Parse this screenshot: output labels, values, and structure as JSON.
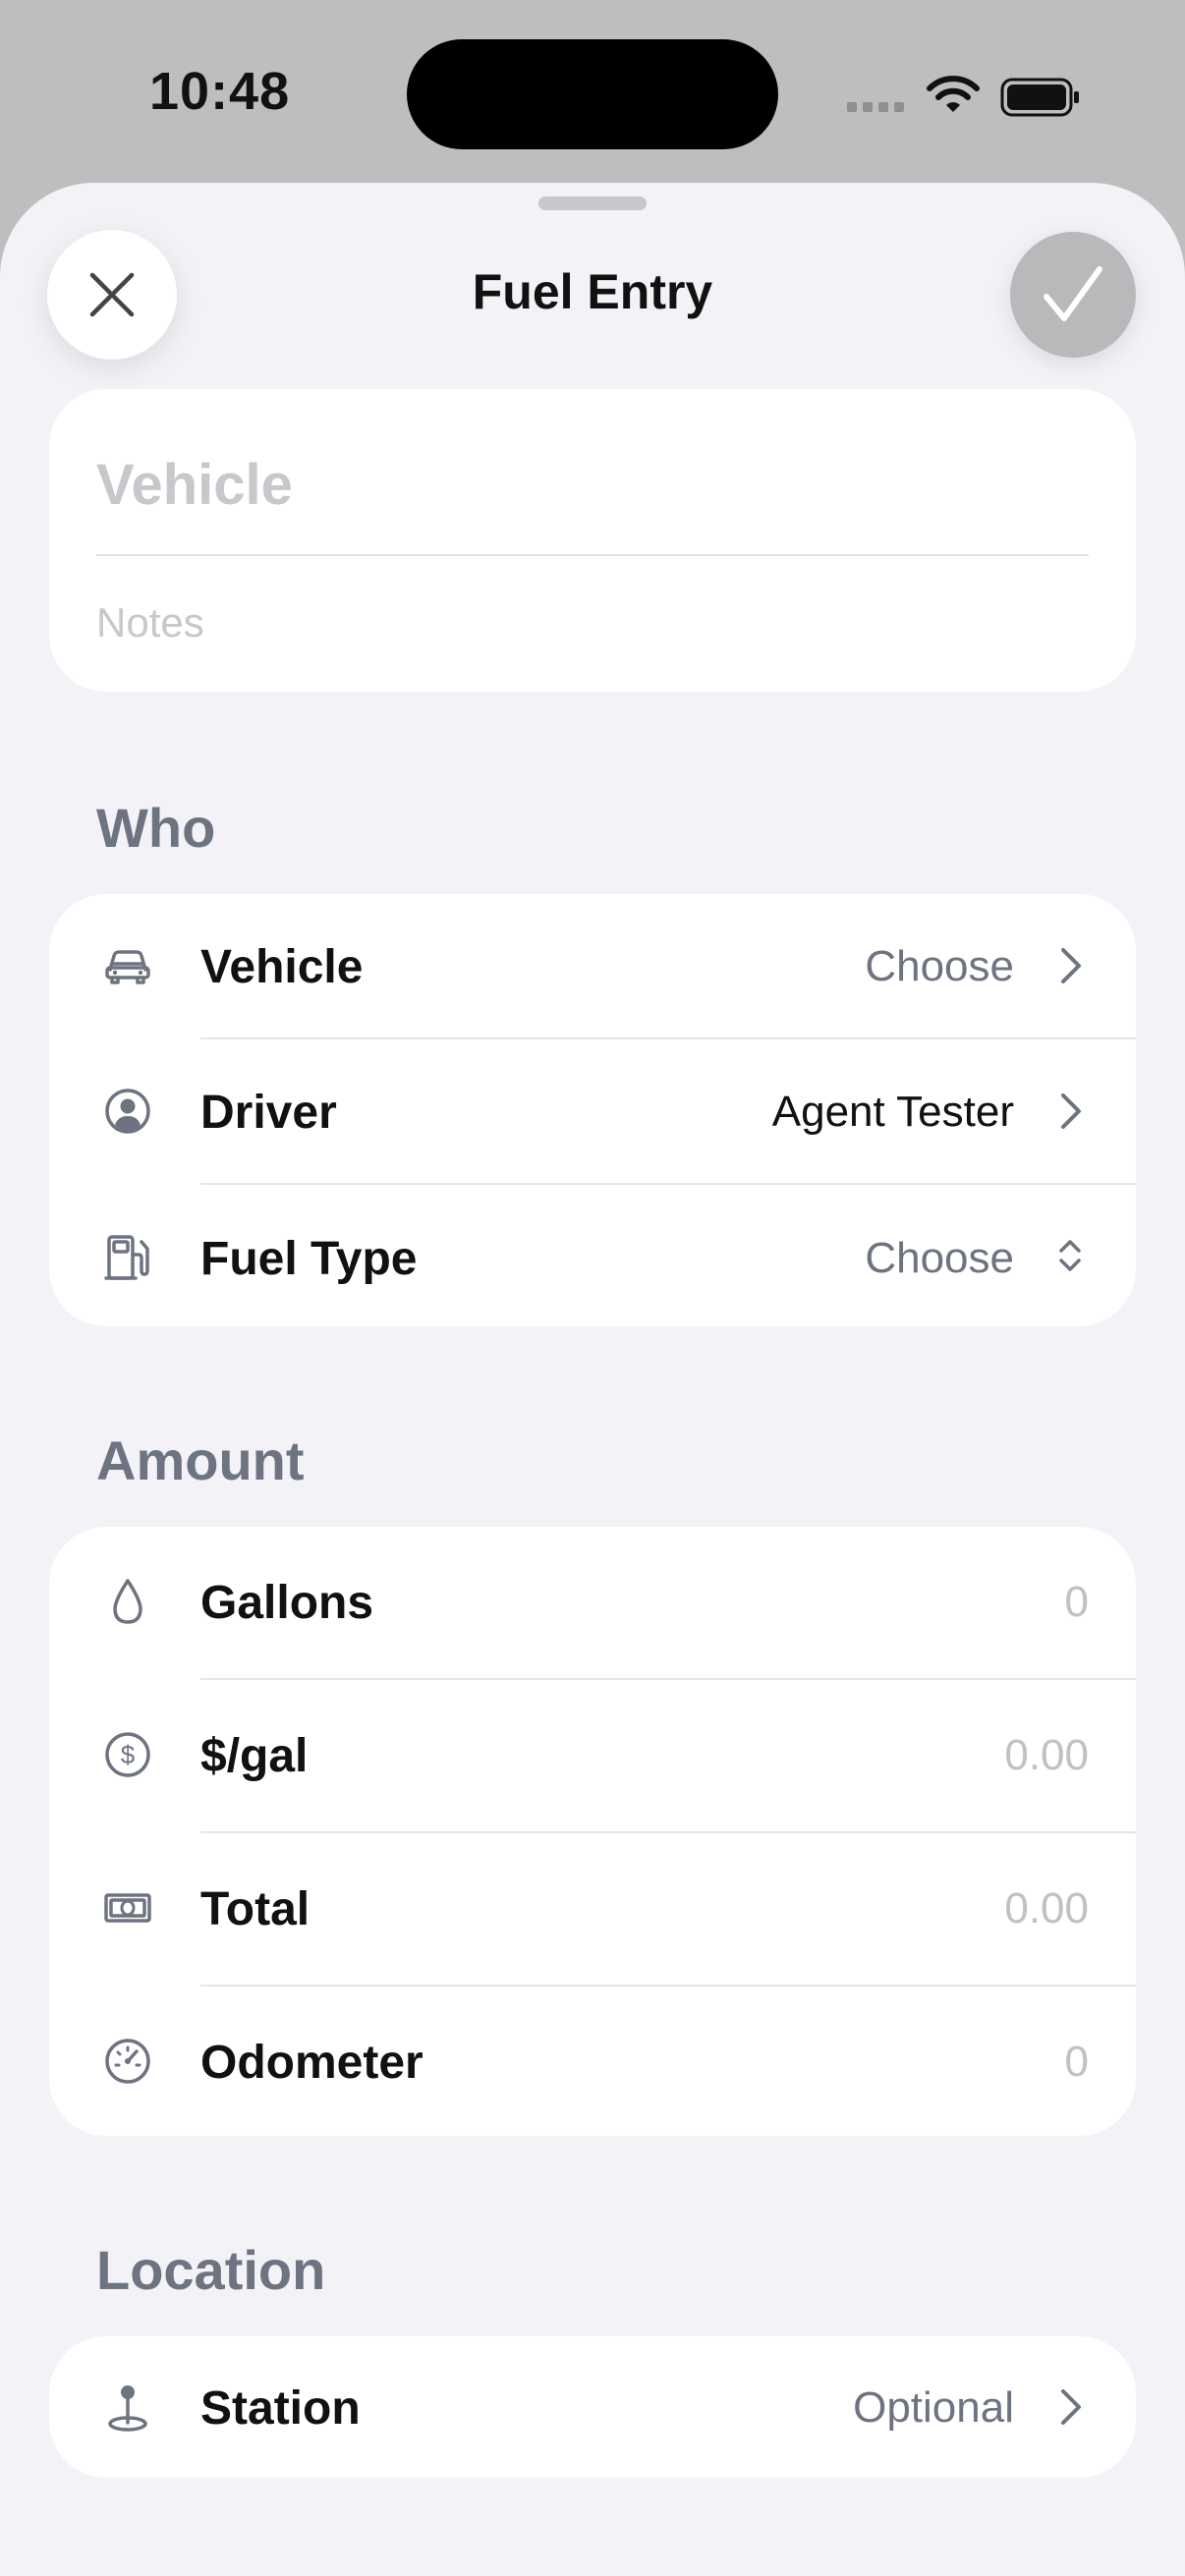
{
  "status_bar": {
    "time": "10:48"
  },
  "sheet": {
    "title": "Fuel Entry"
  },
  "header_card": {
    "vehicle_placeholder": "Vehicle",
    "notes_placeholder": "Notes"
  },
  "sections": {
    "who": {
      "label": "Who",
      "rows": [
        {
          "icon": "car-icon",
          "label": "Vehicle",
          "value": "Choose"
        },
        {
          "icon": "person-circle-icon",
          "label": "Driver",
          "value": "Agent Tester"
        },
        {
          "icon": "fuel-pump-icon",
          "label": "Fuel Type",
          "value": "Choose"
        }
      ]
    },
    "amount": {
      "label": "Amount",
      "rows": [
        {
          "icon": "drop-icon",
          "label": "Gallons",
          "placeholder": "0"
        },
        {
          "icon": "dollar-circle-icon",
          "label": "$/gal",
          "placeholder": "0.00"
        },
        {
          "icon": "banknote-icon",
          "label": "Total",
          "placeholder": "0.00"
        },
        {
          "icon": "gauge-icon",
          "label": "Odometer",
          "placeholder": "0"
        }
      ]
    },
    "location": {
      "label": "Location",
      "rows": [
        {
          "icon": "pin-icon",
          "label": "Station",
          "value": "Optional"
        }
      ]
    }
  }
}
